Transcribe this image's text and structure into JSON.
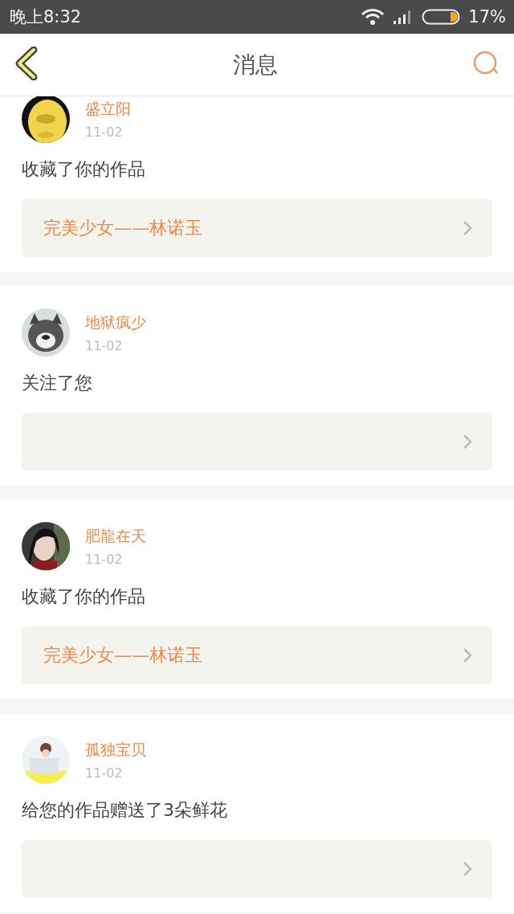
{
  "status_bar": {
    "time": "晚上8:32",
    "battery_percent": "17%"
  },
  "header": {
    "title": "消息"
  },
  "messages": [
    {
      "name": "盛立阳",
      "date": "11-02",
      "action": "收藏了你的作品",
      "work_title": "完美少女——林诺玉"
    },
    {
      "name": "地狱疯少",
      "date": "11-02",
      "action": "关注了您"
    },
    {
      "name": "肥龍在天",
      "date": "11-02",
      "action": "收藏了你的作品",
      "work_title": "完美少女——林诺玉"
    },
    {
      "name": "孤独宝贝",
      "date": "11-02",
      "action": "给您的作品赠送了3朵鲜花"
    }
  ]
}
